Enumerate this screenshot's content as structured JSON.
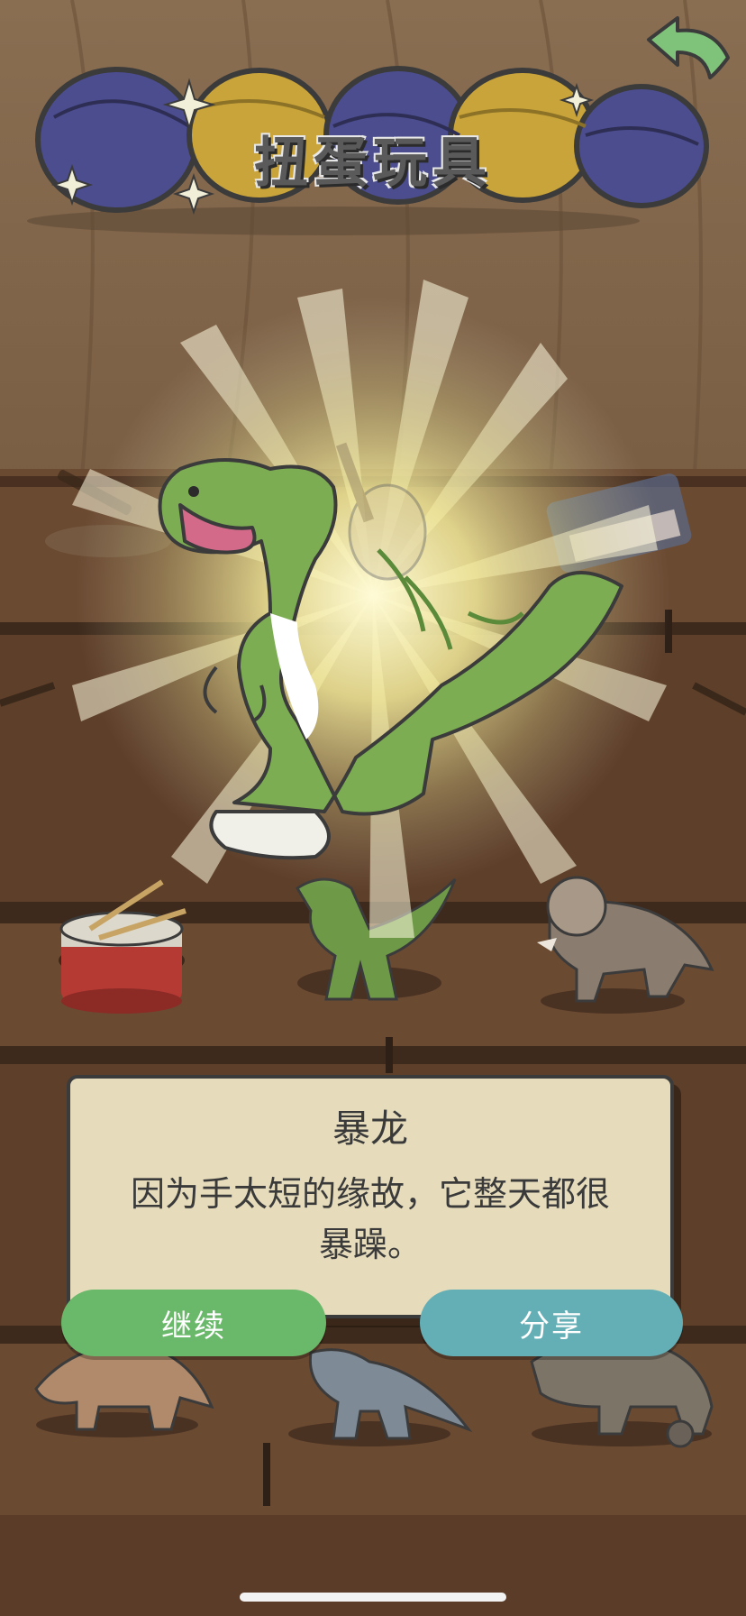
{
  "header": {
    "title": "扭蛋玩具",
    "back_icon": "curved-arrow-back-icon",
    "back_color": "#7fc27a"
  },
  "card": {
    "title": "暴龙",
    "description": "因为手太短的缘故，它整天都很暴躁。"
  },
  "buttons": {
    "continue_label": "继续",
    "share_label": "分享",
    "continue_color": "#6ab86a",
    "share_color": "#64afb6"
  },
  "colors": {
    "background": "#6b4e35",
    "card_background": "#e6dcbc",
    "shelf": "#5b3b26",
    "trex": "#7cad52"
  }
}
